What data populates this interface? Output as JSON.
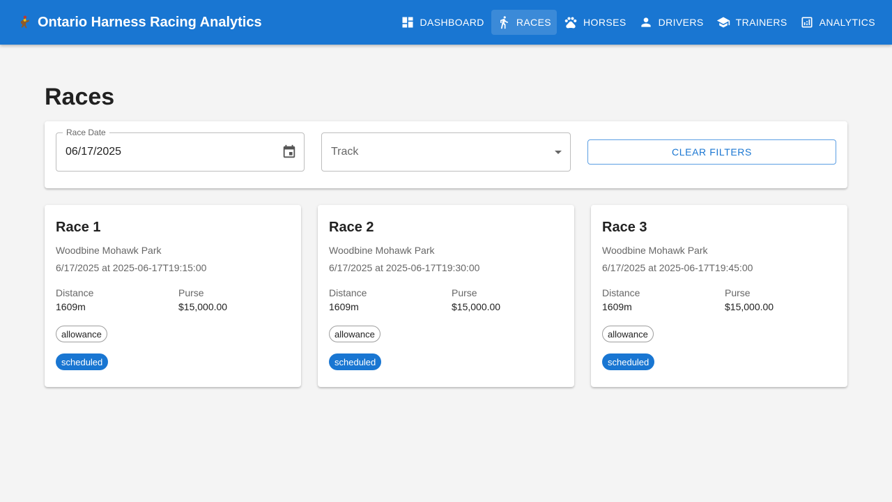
{
  "app": {
    "title": "Ontario Harness Racing Analytics",
    "brand_icon": "horse-racing-icon",
    "primary_color": "#1976d2"
  },
  "nav": {
    "items": [
      {
        "label": "Dashboard",
        "icon": "dashboard-icon",
        "active": false
      },
      {
        "label": "Races",
        "icon": "run-icon",
        "active": true
      },
      {
        "label": "Horses",
        "icon": "paw-icon",
        "active": false
      },
      {
        "label": "Drivers",
        "icon": "person-icon",
        "active": false
      },
      {
        "label": "Trainers",
        "icon": "school-icon",
        "active": false
      },
      {
        "label": "Analytics",
        "icon": "analytics-icon",
        "active": false
      }
    ]
  },
  "page": {
    "title": "Races"
  },
  "filters": {
    "date_label": "Race Date",
    "date_value": "06/17/2025",
    "track_placeholder": "Track",
    "clear_label": "Clear Filters"
  },
  "races": [
    {
      "title": "Race 1",
      "track": "Woodbine Mohawk Park",
      "time": "6/17/2025 at 2025-06-17T19:15:00",
      "distance_label": "Distance",
      "distance": "1609m",
      "purse_label": "Purse",
      "purse": "$15,000.00",
      "type": "allowance",
      "status": "scheduled"
    },
    {
      "title": "Race 2",
      "track": "Woodbine Mohawk Park",
      "time": "6/17/2025 at 2025-06-17T19:30:00",
      "distance_label": "Distance",
      "distance": "1609m",
      "purse_label": "Purse",
      "purse": "$15,000.00",
      "type": "allowance",
      "status": "scheduled"
    },
    {
      "title": "Race 3",
      "track": "Woodbine Mohawk Park",
      "time": "6/17/2025 at 2025-06-17T19:45:00",
      "distance_label": "Distance",
      "distance": "1609m",
      "purse_label": "Purse",
      "purse": "$15,000.00",
      "type": "allowance",
      "status": "scheduled"
    }
  ]
}
